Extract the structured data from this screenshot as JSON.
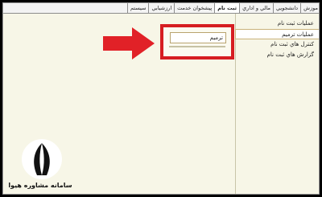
{
  "menubar": {
    "items": [
      {
        "label": "موزش",
        "active": false
      },
      {
        "label": "دانشجويي",
        "active": false
      },
      {
        "label": "مالي و اداري",
        "active": false
      },
      {
        "label": "ثبت نام",
        "active": true
      },
      {
        "label": "پيشخوان خدمت",
        "active": false
      },
      {
        "label": "ارزشيابي",
        "active": false
      },
      {
        "label": "سيستم",
        "active": false
      }
    ]
  },
  "submenu": {
    "items": [
      {
        "label": "عمليات ثبت نام",
        "selected": false
      },
      {
        "label": "عمليات ترميم",
        "selected": true
      },
      {
        "label": "كنترل هاي ثبت نام",
        "selected": false
      },
      {
        "label": "گزارش هاي ثبت نام",
        "selected": false
      }
    ]
  },
  "flyout": {
    "label": "ترميم"
  },
  "highlight": {
    "color": "#d61d22"
  },
  "logo": {
    "text": "سامانه مشاوره هيوا"
  }
}
